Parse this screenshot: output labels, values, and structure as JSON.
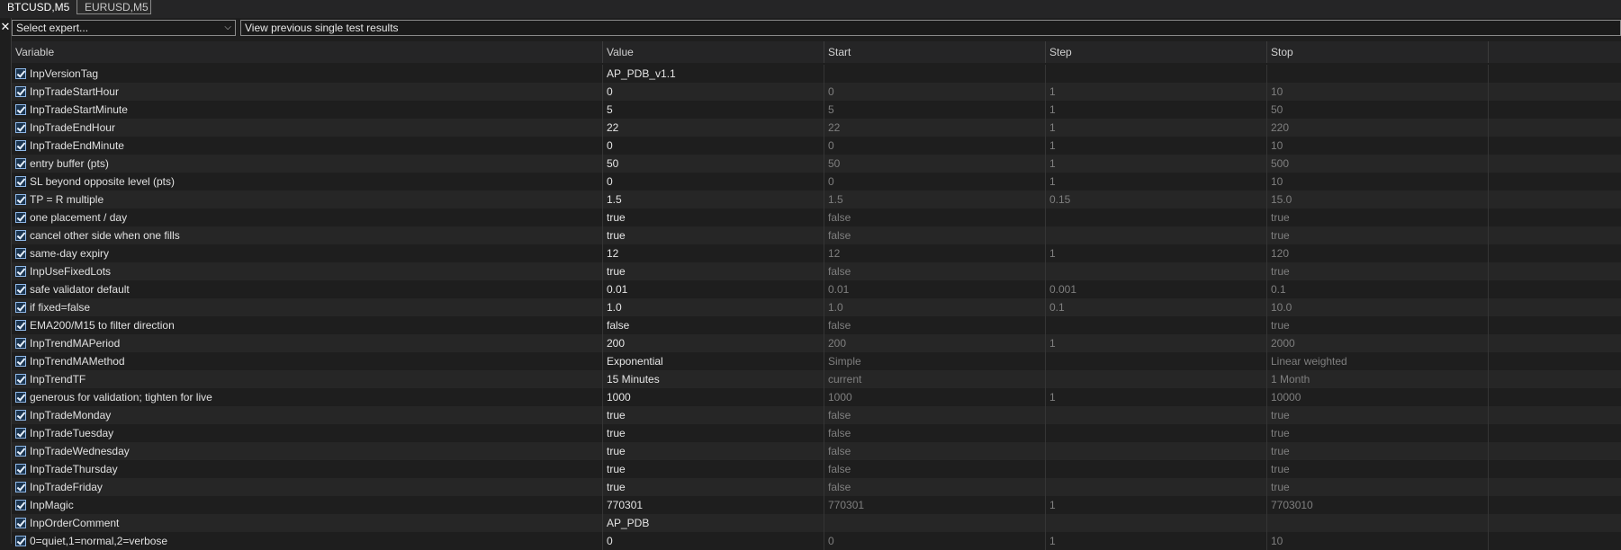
{
  "tabs": [
    "BTCUSD,M5",
    "EURUSD,M5"
  ],
  "toolbar": {
    "expert_select": "Select expert...",
    "view_button": "View previous single test results"
  },
  "columns": [
    "Variable",
    "Value",
    "Start",
    "Step",
    "Stop"
  ],
  "rows": [
    {
      "var": "InpVersionTag",
      "val": "AP_PDB_v1.1",
      "start": "",
      "step": "",
      "stop": ""
    },
    {
      "var": "InpTradeStartHour",
      "val": "0",
      "start": "0",
      "step": "1",
      "stop": "10"
    },
    {
      "var": "InpTradeStartMinute",
      "val": "5",
      "start": "5",
      "step": "1",
      "stop": "50"
    },
    {
      "var": "InpTradeEndHour",
      "val": "22",
      "start": "22",
      "step": "1",
      "stop": "220"
    },
    {
      "var": "InpTradeEndMinute",
      "val": "0",
      "start": "0",
      "step": "1",
      "stop": "10"
    },
    {
      "var": "entry buffer (pts)",
      "val": "50",
      "start": "50",
      "step": "1",
      "stop": "500"
    },
    {
      "var": "SL beyond opposite level (pts)",
      "val": "0",
      "start": "0",
      "step": "1",
      "stop": "10"
    },
    {
      "var": "TP = R multiple",
      "val": "1.5",
      "start": "1.5",
      "step": "0.15",
      "stop": "15.0"
    },
    {
      "var": "one placement / day",
      "val": "true",
      "start": "false",
      "step": "",
      "stop": "true"
    },
    {
      "var": "cancel other side when one fills",
      "val": "true",
      "start": "false",
      "step": "",
      "stop": "true"
    },
    {
      "var": "same-day expiry",
      "val": "12",
      "start": "12",
      "step": "1",
      "stop": "120"
    },
    {
      "var": "InpUseFixedLots",
      "val": "true",
      "start": "false",
      "step": "",
      "stop": "true"
    },
    {
      "var": "safe validator default",
      "val": "0.01",
      "start": "0.01",
      "step": "0.001",
      "stop": "0.1"
    },
    {
      "var": "if fixed=false",
      "val": "1.0",
      "start": "1.0",
      "step": "0.1",
      "stop": "10.0"
    },
    {
      "var": "EMA200/M15 to filter direction",
      "val": "false",
      "start": "false",
      "step": "",
      "stop": "true"
    },
    {
      "var": "InpTrendMAPeriod",
      "val": "200",
      "start": "200",
      "step": "1",
      "stop": "2000"
    },
    {
      "var": "InpTrendMAMethod",
      "val": "Exponential",
      "start": "Simple",
      "step": "",
      "stop": "Linear weighted"
    },
    {
      "var": "InpTrendTF",
      "val": "15 Minutes",
      "start": "current",
      "step": "",
      "stop": "1 Month"
    },
    {
      "var": "generous for validation; tighten for live",
      "val": "1000",
      "start": "1000",
      "step": "1",
      "stop": "10000"
    },
    {
      "var": "InpTradeMonday",
      "val": "true",
      "start": "false",
      "step": "",
      "stop": "true"
    },
    {
      "var": "InpTradeTuesday",
      "val": "true",
      "start": "false",
      "step": "",
      "stop": "true"
    },
    {
      "var": "InpTradeWednesday",
      "val": "true",
      "start": "false",
      "step": "",
      "stop": "true"
    },
    {
      "var": "InpTradeThursday",
      "val": "true",
      "start": "false",
      "step": "",
      "stop": "true"
    },
    {
      "var": "InpTradeFriday",
      "val": "true",
      "start": "false",
      "step": "",
      "stop": "true"
    },
    {
      "var": "InpMagic",
      "val": "770301",
      "start": "770301",
      "step": "1",
      "stop": "7703010"
    },
    {
      "var": "InpOrderComment",
      "val": "AP_PDB",
      "start": "",
      "step": "",
      "stop": ""
    },
    {
      "var": "0=quiet,1=normal,2=verbose",
      "val": "0",
      "start": "0",
      "step": "1",
      "stop": "10"
    }
  ]
}
